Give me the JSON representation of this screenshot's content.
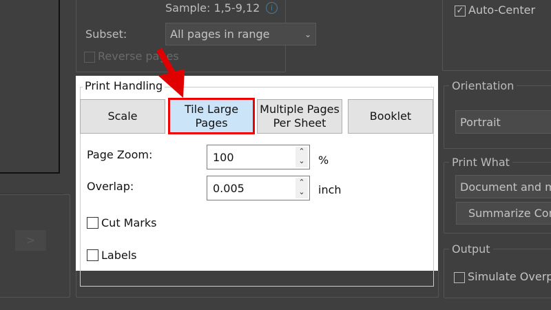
{
  "background": {
    "sample_hint": "Sample: 1,5-9,12",
    "subset_label": "Subset:",
    "subset_value": "All pages in range",
    "reverse_pages": "Reverse pages",
    "auto_center": "Auto-Center",
    "orientation_legend": "Orientation",
    "orientation_value": "Portrait",
    "print_what_legend": "Print What",
    "print_what_value": "Document and m",
    "summarize_button": "Summarize Com",
    "output_legend": "Output",
    "simulate_overprint": "Simulate Overp",
    "next_button": ">"
  },
  "print_handling": {
    "legend": "Print Handling",
    "modes": [
      {
        "label": "Scale",
        "selected": false
      },
      {
        "label": "Tile Large Pages",
        "selected": true
      },
      {
        "label": "Multiple Pages Per Sheet",
        "selected": false
      },
      {
        "label": "Booklet",
        "selected": false
      }
    ],
    "page_zoom_label": "Page Zoom:",
    "page_zoom_value": "100",
    "page_zoom_unit": "%",
    "overlap_label": "Overlap:",
    "overlap_value": "0.005",
    "overlap_unit": "inch",
    "cut_marks": "Cut Marks",
    "labels": "Labels"
  },
  "colors": {
    "highlight": "#e00000",
    "selected_button": "#cce4f7"
  }
}
